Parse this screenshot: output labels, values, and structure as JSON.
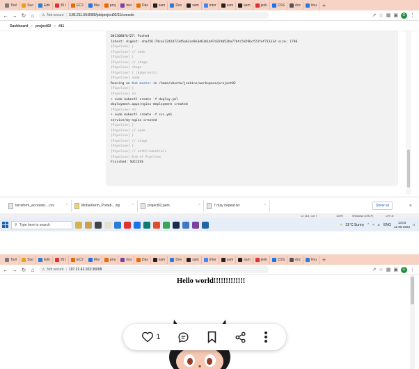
{
  "top_window": {
    "tabs": [
      {
        "label": "Tool"
      },
      {
        "label": "Suo"
      },
      {
        "label": "Edit"
      },
      {
        "label": "35 I"
      },
      {
        "label": "EC2"
      },
      {
        "label": "Mai"
      },
      {
        "label": "proj"
      },
      {
        "label": "Insi"
      },
      {
        "label": "Das"
      },
      {
        "label": "sam"
      },
      {
        "label": "Dev"
      },
      {
        "label": "sam"
      },
      {
        "label": "Inter"
      },
      {
        "label": "sam"
      },
      {
        "label": "sam"
      },
      {
        "label": "jenk"
      },
      {
        "label": "CSS"
      },
      {
        "label": "doc"
      },
      {
        "label": "linu"
      }
    ],
    "address": {
      "security": "Not secure",
      "url": "3.86.211.59:8080/job/project02/11/console"
    },
    "breadcrumb": [
      "Dashboard",
      "project02",
      "#11"
    ],
    "console_lines": [
      {
        "text": "0013080fbf27: Pushed",
        "style": "dark"
      },
      {
        "text": "latest: digest: sha256:74ce22241472345ab2ce8b3d61b1b97d324052ba77bfc5d29bcf23fef713334 size: 1780",
        "style": "dark"
      },
      {
        "text": "[Pipeline] }",
        "style": "grey"
      },
      {
        "text": "[Pipeline] // node",
        "style": "grey"
      },
      {
        "text": "[Pipeline] }",
        "style": "grey"
      },
      {
        "text": "[Pipeline] // stage",
        "style": "grey"
      },
      {
        "text": "[Pipeline] stage",
        "style": "grey"
      },
      {
        "text": "[Pipeline] { (Kubernets)",
        "style": "grey"
      },
      {
        "text": "[Pipeline] node",
        "style": "grey"
      },
      {
        "text": "Running on Kub master in /home/ubuntu/jenkins/workspace/project02",
        "style": "dark"
      },
      {
        "text": "[Pipeline] {",
        "style": "grey"
      },
      {
        "text": "[Pipeline] sh",
        "style": "grey"
      },
      {
        "text": "+ sudo kubectl create -f deploy.yml",
        "style": "dark"
      },
      {
        "text": "deployment.apps/nginx-deployment created",
        "style": "dark"
      },
      {
        "text": "[Pipeline] sh",
        "style": "grey"
      },
      {
        "text": "+ sudo kubectl create -f svc.yml",
        "style": "dark"
      },
      {
        "text": "service/my-nginx created",
        "style": "dark"
      },
      {
        "text": "[Pipeline] }",
        "style": "grey"
      },
      {
        "text": "[Pipeline] // node",
        "style": "grey"
      },
      {
        "text": "[Pipeline] }",
        "style": "grey"
      },
      {
        "text": "[Pipeline] // stage",
        "style": "grey"
      },
      {
        "text": "[Pipeline] }",
        "style": "grey"
      },
      {
        "text": "[Pipeline] // withCredentials",
        "style": "grey"
      },
      {
        "text": "[Pipeline] End of Pipeline",
        "style": "grey"
      },
      {
        "text": "Finished: SUCCESS",
        "style": "dark"
      }
    ],
    "downloads": [
      {
        "name": "terraform_accessto....csv"
      },
      {
        "name": "MobaXterm_Portab....zip"
      },
      {
        "name": "project02.pem"
      },
      {
        "name": "7 may /repeat.txt"
      }
    ],
    "show_all": "Show all",
    "statusbar": {
      "position": "Ln 118, Col 7",
      "zoom": "100%",
      "eol": "Windows (CRLF)",
      "encoding": "UTF-8"
    },
    "taskbar": {
      "search_placeholder": "Type here to search",
      "weather": "31°C Sunny",
      "lang": "ENG",
      "time": "13:03",
      "date": "12-05-2023"
    }
  },
  "bottom_window": {
    "tabs": [
      {
        "label": "Tool"
      },
      {
        "label": "Suo"
      },
      {
        "label": "Edit"
      },
      {
        "label": "35 I"
      },
      {
        "label": "EC2"
      },
      {
        "label": "Mai"
      },
      {
        "label": "proj"
      },
      {
        "label": "Insi"
      },
      {
        "label": "Das"
      },
      {
        "label": "sam"
      },
      {
        "label": "Dev"
      },
      {
        "label": "sam"
      },
      {
        "label": "Inter"
      },
      {
        "label": "sam"
      },
      {
        "label": "sam"
      },
      {
        "label": "jenk"
      },
      {
        "label": "CSS"
      },
      {
        "label": "doc"
      },
      {
        "label": "linu"
      }
    ],
    "address": {
      "security": "Not secure",
      "url": "107.21.42.102:30008"
    },
    "heading": "Hello world!!!!!!!!!!!!!",
    "like_count": "1"
  },
  "colors": {
    "tab_strip": "#f6d3c4",
    "console_bg": "#f2f2f2",
    "link": "#1a5ec2",
    "taskbar": "#e7eef8"
  }
}
